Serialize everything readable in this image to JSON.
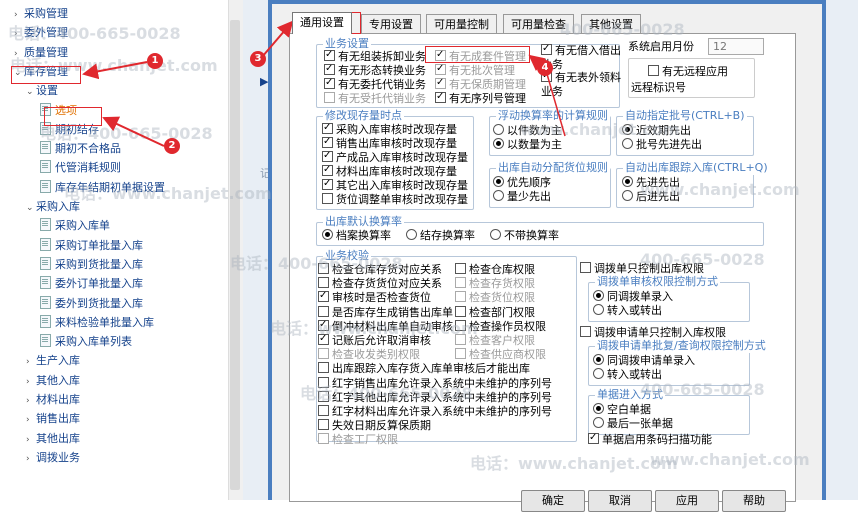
{
  "tree": {
    "items": [
      {
        "label": "采购管理",
        "arrow": "›"
      },
      {
        "label": "委外管理",
        "arrow": "›"
      },
      {
        "label": "质量管理",
        "arrow": "›"
      },
      {
        "label": "库存管理",
        "arrow": "⌄"
      },
      {
        "label": "设置",
        "arrow": "⌄"
      },
      {
        "label": "选项"
      },
      {
        "label": "期初结存"
      },
      {
        "label": "期初不合格品"
      },
      {
        "label": "代管消耗规则"
      },
      {
        "label": "库存年结期初单据设置"
      },
      {
        "label": "采购入库",
        "arrow": "⌄"
      },
      {
        "label": "采购入库单"
      },
      {
        "label": "采购订单批量入库"
      },
      {
        "label": "采购到货批量入库"
      },
      {
        "label": "委外订单批量入库"
      },
      {
        "label": "委外到货批量入库"
      },
      {
        "label": "来料检验单批量入库"
      },
      {
        "label": "采购入库单列表"
      },
      {
        "label": "生产入库",
        "arrow": "›"
      },
      {
        "label": "其他入库",
        "arrow": "›"
      },
      {
        "label": "材料出库",
        "arrow": "›"
      },
      {
        "label": "销售出库",
        "arrow": "›"
      },
      {
        "label": "其他出库",
        "arrow": "›"
      },
      {
        "label": "调拨业务",
        "arrow": "›"
      }
    ]
  },
  "watermark": {
    "phone": "400-665-0028",
    "site": "www.chanjet.com",
    "prefix": "电话："
  },
  "bg": {
    "t1": "有",
    "t2": "我的",
    "t3": "记"
  },
  "tabs": [
    "通用设置",
    "专用设置",
    "可用量控制",
    "可用量检查",
    "其他设置"
  ],
  "business_settings": {
    "title": "业务设置",
    "items": [
      {
        "label": "有无组装拆卸业务",
        "checked": true,
        "disabled": false
      },
      {
        "label": "有无形态转换业务",
        "checked": true,
        "disabled": false
      },
      {
        "label": "有无委托代销业务",
        "checked": true,
        "disabled": false
      },
      {
        "label": "有无受托代销业务",
        "checked": false,
        "disabled": true
      },
      {
        "label": "有无成套件管理",
        "checked": true,
        "disabled": true
      },
      {
        "label": "有无批次管理",
        "checked": true,
        "disabled": true
      },
      {
        "label": "有无保质期管理",
        "checked": true,
        "disabled": true
      },
      {
        "label": "有无序列号管理",
        "checked": true,
        "disabled": false
      },
      {
        "label": "有无借入借出业务",
        "checked": true,
        "disabled": false
      },
      {
        "label": "有无表外领料业务",
        "checked": true,
        "disabled": false
      }
    ],
    "month_label": "系统启用月份",
    "month_value": "12",
    "remote_label": "有无远程应用",
    "remote_code_label": "远程标识号"
  },
  "revise_stock": {
    "title": "修改现存量时点",
    "items": [
      {
        "label": "采购入库审核时改现存量",
        "checked": true,
        "disabled": false
      },
      {
        "label": "销售出库审核时改现存量",
        "checked": true,
        "disabled": false
      },
      {
        "label": "产成品入库审核时改现存量",
        "checked": true,
        "disabled": false
      },
      {
        "label": "材料出库审核时改现存量",
        "checked": true,
        "disabled": false
      },
      {
        "label": "其它出入库审核时改现存量",
        "checked": true,
        "disabled": false
      },
      {
        "label": "货位调整单审核时改现存量",
        "checked": false,
        "disabled": false
      }
    ]
  },
  "float_rule": {
    "title": "浮动换算率的计算规则",
    "options": [
      "以件数为主",
      "以数量为主"
    ],
    "selected": 1
  },
  "auto_batch": {
    "title": "自动指定批号(CTRL+B)",
    "options": [
      "近效期先出",
      "批号先进先出"
    ],
    "selected": 0
  },
  "auto_loc": {
    "title": "出库自动分配货位规则",
    "options": [
      "优先顺序",
      "量少先出"
    ],
    "selected": 0
  },
  "auto_track": {
    "title": "自动出库跟踪入库(CTRL+Q)",
    "options": [
      "先进先出",
      "后进先出"
    ],
    "selected": 0
  },
  "default_rate": {
    "title": "出库默认换算率",
    "options": [
      "档案换算率",
      "结存换算率",
      "不带换算率"
    ],
    "selected": 0
  },
  "business_check": {
    "title": "业务校验",
    "col1": [
      {
        "label": "检查仓库存货对应关系",
        "checked": false,
        "disabled": false
      },
      {
        "label": "检查存货货位对应关系",
        "checked": false,
        "disabled": false
      },
      {
        "label": "审核时是否检查货位",
        "checked": true,
        "disabled": false
      },
      {
        "label": "是否库存生成销售出库单",
        "checked": false,
        "disabled": false
      },
      {
        "label": "倒冲材料出库单自动审核",
        "checked": true,
        "disabled": false
      },
      {
        "label": "记账后允许取消审核",
        "checked": true,
        "disabled": false
      },
      {
        "label": "检查收发类别权限",
        "checked": false,
        "disabled": true
      },
      {
        "label": "出库跟踪入库存货入库单审核后才能出库",
        "checked": false,
        "disabled": false
      },
      {
        "label": "红字销售出库允许录入系统中未维护的序列号",
        "checked": false,
        "disabled": false
      },
      {
        "label": "红字其他出库允许录入系统中未维护的序列号",
        "checked": false,
        "disabled": false
      },
      {
        "label": "红字材料出库允许录入系统中未维护的序列号",
        "checked": false,
        "disabled": false
      },
      {
        "label": "失效日期反算保质期",
        "checked": false,
        "disabled": false
      },
      {
        "label": "检查工厂权限",
        "checked": false,
        "disabled": true
      }
    ],
    "col2": [
      {
        "label": "检查仓库权限",
        "checked": false,
        "disabled": false
      },
      {
        "label": "检查存货权限",
        "checked": false,
        "disabled": true
      },
      {
        "label": "检查货位权限",
        "checked": false,
        "disabled": true
      },
      {
        "label": "检查部门权限",
        "checked": false,
        "disabled": false
      },
      {
        "label": "检查操作员权限",
        "checked": false,
        "disabled": false
      },
      {
        "label": "检查客户权限",
        "checked": false,
        "disabled": true
      },
      {
        "label": "检查供应商权限",
        "checked": false,
        "disabled": true
      }
    ]
  },
  "transfer_out": {
    "check": "调拨单只控制出库权限",
    "title": "调拨单审核权限控制方式",
    "options": [
      "同调拨单录入",
      "转入或转出"
    ],
    "selected": 0
  },
  "transfer_req": {
    "check": "调拨申请单只控制入库权限",
    "title": "调拨申请单批复/查询权限控制方式",
    "options": [
      "同调拨申请单录入",
      "转入或转出"
    ],
    "selected": 0
  },
  "doc_entry": {
    "title": "单据进入方式",
    "options": [
      "空白单据",
      "最后一张单据"
    ],
    "selected": 0,
    "barcode": "单据启用条码扫描功能",
    "barcode_checked": true
  },
  "buttons": {
    "ok": "确定",
    "cancel": "取消",
    "apply": "应用",
    "help": "帮助"
  },
  "annotations": {
    "n1": "1",
    "n2": "2",
    "n3": "3",
    "n4": "4"
  },
  "colors": {
    "accent": "#4a7ec0",
    "annotation": "#e0282e",
    "tree_text": "#15428b"
  }
}
